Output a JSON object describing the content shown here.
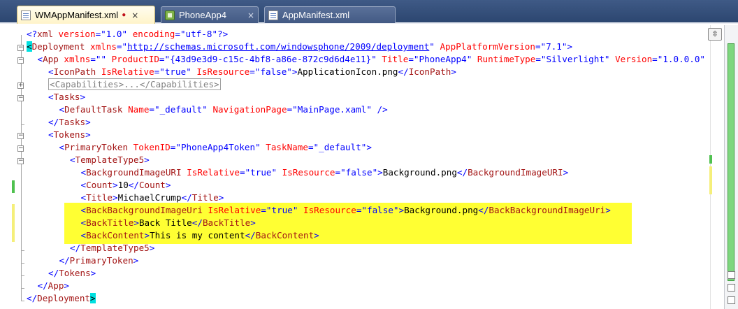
{
  "tabs": [
    {
      "label": "WMAppManifest.xml",
      "active": true,
      "modified": true,
      "dirty_mark": "●",
      "close": "×"
    },
    {
      "label": "PhoneApp4",
      "active": false,
      "close": "×"
    },
    {
      "label": "AppManifest.xml",
      "active": false,
      "close": ""
    }
  ],
  "editor": {
    "split_button": "⇳",
    "fold_minus": "−",
    "fold_plus": "+",
    "highlight_color": "#ffff33",
    "lines": [
      {
        "indent": 0,
        "tokens": [
          [
            "br",
            "<?"
          ],
          [
            "el",
            "xml"
          ],
          [
            "at",
            " version"
          ],
          [
            "br",
            "=\""
          ],
          [
            "av",
            "1.0"
          ],
          [
            "br",
            "\""
          ],
          [
            "at",
            " encoding"
          ],
          [
            "br",
            "=\""
          ],
          [
            "av",
            "utf-8"
          ],
          [
            "br",
            "\""
          ],
          [
            "br",
            "?>"
          ]
        ]
      },
      {
        "indent": 0,
        "tokens": [
          [
            "bm",
            "<"
          ],
          [
            "el",
            "Deployment"
          ],
          [
            "at",
            " xmlns"
          ],
          [
            "br",
            "=\""
          ],
          [
            "ln",
            "http://schemas.microsoft.com/windowsphone/2009/deployment"
          ],
          [
            "br",
            "\""
          ],
          [
            "at",
            " AppPlatformVersion"
          ],
          [
            "br",
            "=\""
          ],
          [
            "av",
            "7.1"
          ],
          [
            "br",
            "\">"
          ]
        ]
      },
      {
        "indent": 1,
        "tokens": [
          [
            "br",
            "<"
          ],
          [
            "el",
            "App"
          ],
          [
            "at",
            " xmlns"
          ],
          [
            "br",
            "=\"\""
          ],
          [
            "at",
            " ProductID"
          ],
          [
            "br",
            "=\""
          ],
          [
            "av",
            "{43d9e3d9-c15c-4bf8-a86e-872c9d6d4e11}"
          ],
          [
            "br",
            "\""
          ],
          [
            "at",
            " Title"
          ],
          [
            "br",
            "=\""
          ],
          [
            "av",
            "PhoneApp4"
          ],
          [
            "br",
            "\""
          ],
          [
            "at",
            " RuntimeType"
          ],
          [
            "br",
            "=\""
          ],
          [
            "av",
            "Silverlight"
          ],
          [
            "br",
            "\""
          ],
          [
            "at",
            " Version"
          ],
          [
            "br",
            "=\""
          ],
          [
            "av",
            "1.0.0.0"
          ],
          [
            "br",
            "\""
          ]
        ]
      },
      {
        "indent": 2,
        "tokens": [
          [
            "br",
            "<"
          ],
          [
            "el",
            "IconPath"
          ],
          [
            "at",
            " IsRelative"
          ],
          [
            "br",
            "=\""
          ],
          [
            "av",
            "true"
          ],
          [
            "br",
            "\""
          ],
          [
            "at",
            " IsResource"
          ],
          [
            "br",
            "=\""
          ],
          [
            "av",
            "false"
          ],
          [
            "br",
            "\">"
          ],
          [
            "tx",
            "ApplicationIcon.png"
          ],
          [
            "br",
            "</"
          ],
          [
            "el",
            "IconPath"
          ],
          [
            "br",
            ">"
          ]
        ]
      },
      {
        "indent": 2,
        "tokens": [
          [
            "col-box",
            "<Capabilities>...</Capabilities>"
          ]
        ]
      },
      {
        "indent": 2,
        "tokens": [
          [
            "br",
            "<"
          ],
          [
            "el",
            "Tasks"
          ],
          [
            "br",
            ">"
          ]
        ]
      },
      {
        "indent": 3,
        "tokens": [
          [
            "br",
            "<"
          ],
          [
            "el",
            "DefaultTask"
          ],
          [
            "at",
            " Name"
          ],
          [
            "br",
            "=\""
          ],
          [
            "av",
            "_default"
          ],
          [
            "br",
            "\""
          ],
          [
            "at",
            " NavigationPage"
          ],
          [
            "br",
            "=\""
          ],
          [
            "av",
            "MainPage.xaml"
          ],
          [
            "br",
            "\""
          ],
          [
            "br",
            " />"
          ]
        ]
      },
      {
        "indent": 2,
        "tokens": [
          [
            "br",
            "</"
          ],
          [
            "el",
            "Tasks"
          ],
          [
            "br",
            ">"
          ]
        ]
      },
      {
        "indent": 2,
        "tokens": [
          [
            "br",
            "<"
          ],
          [
            "el",
            "Tokens"
          ],
          [
            "br",
            ">"
          ]
        ]
      },
      {
        "indent": 3,
        "tokens": [
          [
            "br",
            "<"
          ],
          [
            "el",
            "PrimaryToken"
          ],
          [
            "at",
            " TokenID"
          ],
          [
            "br",
            "=\""
          ],
          [
            "av",
            "PhoneApp4Token"
          ],
          [
            "br",
            "\""
          ],
          [
            "at",
            " TaskName"
          ],
          [
            "br",
            "=\""
          ],
          [
            "av",
            "_default"
          ],
          [
            "br",
            "\">"
          ]
        ]
      },
      {
        "indent": 4,
        "tokens": [
          [
            "br",
            "<"
          ],
          [
            "el",
            "TemplateType5"
          ],
          [
            "br",
            ">"
          ]
        ]
      },
      {
        "indent": 5,
        "tokens": [
          [
            "br",
            "<"
          ],
          [
            "el",
            "BackgroundImageURI"
          ],
          [
            "at",
            " IsRelative"
          ],
          [
            "br",
            "=\""
          ],
          [
            "av",
            "true"
          ],
          [
            "br",
            "\""
          ],
          [
            "at",
            " IsResource"
          ],
          [
            "br",
            "=\""
          ],
          [
            "av",
            "false"
          ],
          [
            "br",
            "\">"
          ],
          [
            "tx",
            "Background.png"
          ],
          [
            "br",
            "</"
          ],
          [
            "el",
            "BackgroundImageURI"
          ],
          [
            "br",
            ">"
          ]
        ]
      },
      {
        "indent": 5,
        "tokens": [
          [
            "br",
            "<"
          ],
          [
            "el",
            "Count"
          ],
          [
            "br",
            ">"
          ],
          [
            "tx",
            "10"
          ],
          [
            "br",
            "</"
          ],
          [
            "el",
            "Count"
          ],
          [
            "br",
            ">"
          ]
        ]
      },
      {
        "indent": 5,
        "tokens": [
          [
            "br",
            "<"
          ],
          [
            "el",
            "Title"
          ],
          [
            "br",
            ">"
          ],
          [
            "tx",
            "MichaelCrump"
          ],
          [
            "br",
            "</"
          ],
          [
            "el",
            "Title"
          ],
          [
            "br",
            ">"
          ]
        ]
      },
      {
        "indent": 5,
        "tokens": [
          [
            "br",
            "<"
          ],
          [
            "el",
            "BackBackgroundImageUri"
          ],
          [
            "at",
            " IsRelative"
          ],
          [
            "br",
            "=\""
          ],
          [
            "av",
            "true"
          ],
          [
            "br",
            "\""
          ],
          [
            "at",
            " IsResource"
          ],
          [
            "br",
            "=\""
          ],
          [
            "av",
            "false"
          ],
          [
            "br",
            "\">"
          ],
          [
            "tx",
            "Background.png"
          ],
          [
            "br",
            "</"
          ],
          [
            "el",
            "BackBackgroundImageUri"
          ],
          [
            "br",
            ">"
          ]
        ]
      },
      {
        "indent": 5,
        "tokens": [
          [
            "br",
            "<"
          ],
          [
            "el",
            "BackTitle"
          ],
          [
            "br",
            ">"
          ],
          [
            "tx",
            "Back Title"
          ],
          [
            "br",
            "</"
          ],
          [
            "el",
            "BackTitle"
          ],
          [
            "br",
            ">"
          ]
        ]
      },
      {
        "indent": 5,
        "tokens": [
          [
            "br",
            "<"
          ],
          [
            "el",
            "BackContent"
          ],
          [
            "br",
            ">"
          ],
          [
            "tx",
            "This is my content"
          ],
          [
            "br",
            "</"
          ],
          [
            "el",
            "BackContent"
          ],
          [
            "br",
            ">"
          ]
        ]
      },
      {
        "indent": 4,
        "tokens": [
          [
            "br",
            "</"
          ],
          [
            "el",
            "TemplateType5"
          ],
          [
            "br",
            ">"
          ]
        ]
      },
      {
        "indent": 3,
        "tokens": [
          [
            "br",
            "</"
          ],
          [
            "el",
            "PrimaryToken"
          ],
          [
            "br",
            ">"
          ]
        ]
      },
      {
        "indent": 2,
        "tokens": [
          [
            "br",
            "</"
          ],
          [
            "el",
            "Tokens"
          ],
          [
            "br",
            ">"
          ]
        ]
      },
      {
        "indent": 1,
        "tokens": [
          [
            "br",
            "</"
          ],
          [
            "el",
            "App"
          ],
          [
            "br",
            ">"
          ]
        ]
      },
      {
        "indent": 0,
        "tokens": [
          [
            "br",
            "</"
          ],
          [
            "el",
            "Deployment"
          ],
          [
            "bm",
            ">"
          ]
        ]
      }
    ]
  }
}
